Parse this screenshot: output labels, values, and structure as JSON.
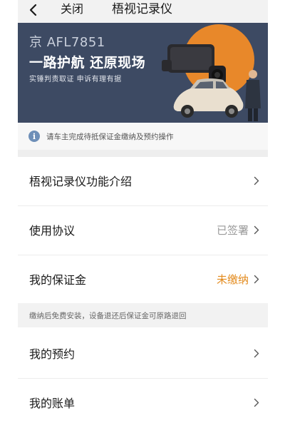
{
  "nav": {
    "close_label": "关闭",
    "title": "梧视记录仪"
  },
  "banner": {
    "plate": "京 AFL7851",
    "slogan": "一路护航 还原现场",
    "subtitle": "实锤判责取证 申诉有理有据"
  },
  "notice": {
    "icon": "info-icon",
    "text": "请车主完成待抵保证金缴纳及预约操作"
  },
  "menu": [
    {
      "label": "梧视记录仪功能介绍",
      "value": ""
    },
    {
      "label": "使用协议",
      "value": "已签署"
    },
    {
      "label": "我的保证金",
      "value": "未缴纳"
    },
    {
      "label": "我的预约",
      "value": ""
    },
    {
      "label": "我的账单",
      "value": ""
    }
  ],
  "deposit_note": "缴纳后免费安装，设备退还后保证金可原路退回",
  "colors": {
    "banner_bg": "#3d4a63",
    "unpaid": "#e38a1c",
    "info_icon": "#6e8fb8"
  }
}
